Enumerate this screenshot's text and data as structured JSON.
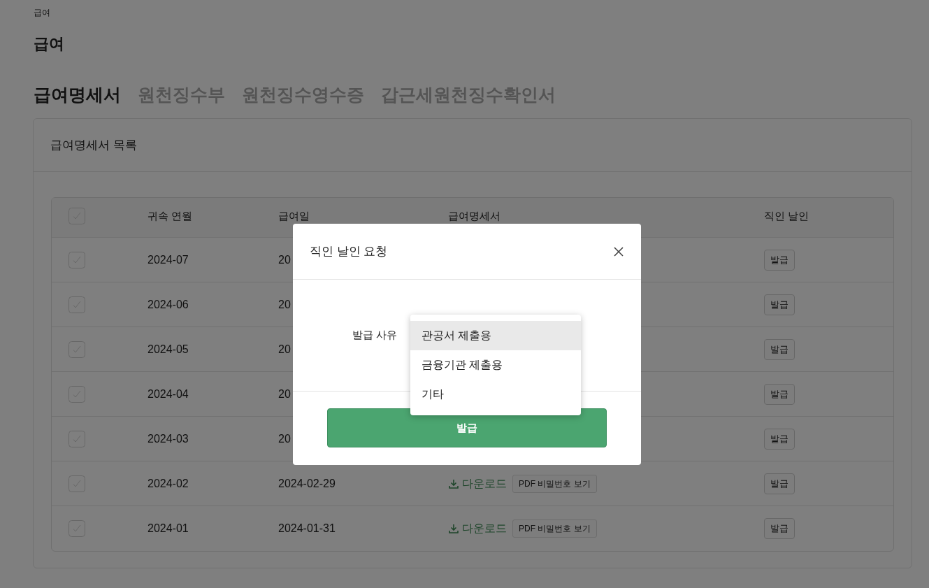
{
  "breadcrumb": "급여",
  "page_title": "급여",
  "tabs": [
    {
      "label": "급여명세서",
      "selected": true
    },
    {
      "label": "원천징수부",
      "selected": false
    },
    {
      "label": "원천징수영수증",
      "selected": false
    },
    {
      "label": "갑근세원천징수확인서",
      "selected": false
    }
  ],
  "card_title": "급여명세서 목록",
  "table": {
    "columns": [
      "귀속 연월",
      "급여일",
      "급여명세서",
      "직인 날인"
    ],
    "rows": [
      {
        "month": "2024-07",
        "pay_date": "20",
        "download": null,
        "pdf_button": null,
        "issue_button": "발급"
      },
      {
        "month": "2024-06",
        "pay_date": "20",
        "download": null,
        "pdf_button": null,
        "issue_button": "발급"
      },
      {
        "month": "2024-05",
        "pay_date": "20",
        "download": null,
        "pdf_button": null,
        "issue_button": "발급"
      },
      {
        "month": "2024-04",
        "pay_date": "20",
        "download": null,
        "pdf_button": null,
        "issue_button": "발급"
      },
      {
        "month": "2024-03",
        "pay_date": "20",
        "download": null,
        "pdf_button": null,
        "issue_button": "발급"
      },
      {
        "month": "2024-02",
        "pay_date": "2024-02-29",
        "download": "다운로드",
        "pdf_button": "PDF 비밀번호 보기",
        "issue_button": "발급"
      },
      {
        "month": "2024-01",
        "pay_date": "2024-01-31",
        "download": "다운로드",
        "pdf_button": "PDF 비밀번호 보기",
        "issue_button": "발급"
      }
    ]
  },
  "modal": {
    "title": "직인 날인 요청",
    "field_label": "발급 사유",
    "options": [
      {
        "label": "관공서 제출용",
        "highlighted": true
      },
      {
        "label": "금융기관 제출용",
        "highlighted": false
      },
      {
        "label": "기타",
        "highlighted": false
      }
    ],
    "submit_button": "발급"
  }
}
